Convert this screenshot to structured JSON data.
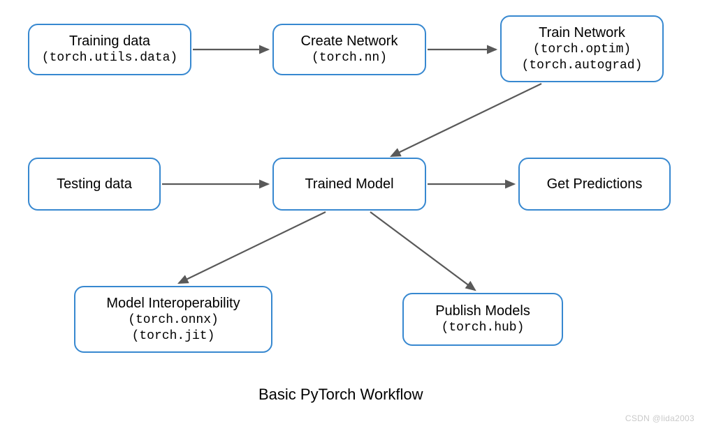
{
  "nodes": {
    "training_data": {
      "title": "Training data",
      "sub1": "(torch.utils.data)"
    },
    "create_network": {
      "title": "Create Network",
      "sub1": "(torch.nn)"
    },
    "train_network": {
      "title": "Train Network",
      "sub1": "(torch.optim)",
      "sub2": "(torch.autograd)"
    },
    "testing_data": {
      "title": "Testing data"
    },
    "trained_model": {
      "title": "Trained Model"
    },
    "get_predictions": {
      "title": "Get Predictions"
    },
    "model_interop": {
      "title": "Model Interoperability",
      "sub1": "(torch.onnx)",
      "sub2": "(torch.jit)"
    },
    "publish_models": {
      "title": "Publish Models",
      "sub1": "(torch.hub)"
    }
  },
  "caption": "Basic PyTorch Workflow",
  "watermark": "CSDN @lida2003",
  "colors": {
    "border": "#3788d0",
    "arrow": "#595959"
  },
  "edges": [
    {
      "from": "training_data",
      "to": "create_network"
    },
    {
      "from": "create_network",
      "to": "train_network"
    },
    {
      "from": "train_network",
      "to": "trained_model"
    },
    {
      "from": "testing_data",
      "to": "trained_model"
    },
    {
      "from": "trained_model",
      "to": "get_predictions"
    },
    {
      "from": "trained_model",
      "to": "model_interop"
    },
    {
      "from": "trained_model",
      "to": "publish_models"
    }
  ]
}
